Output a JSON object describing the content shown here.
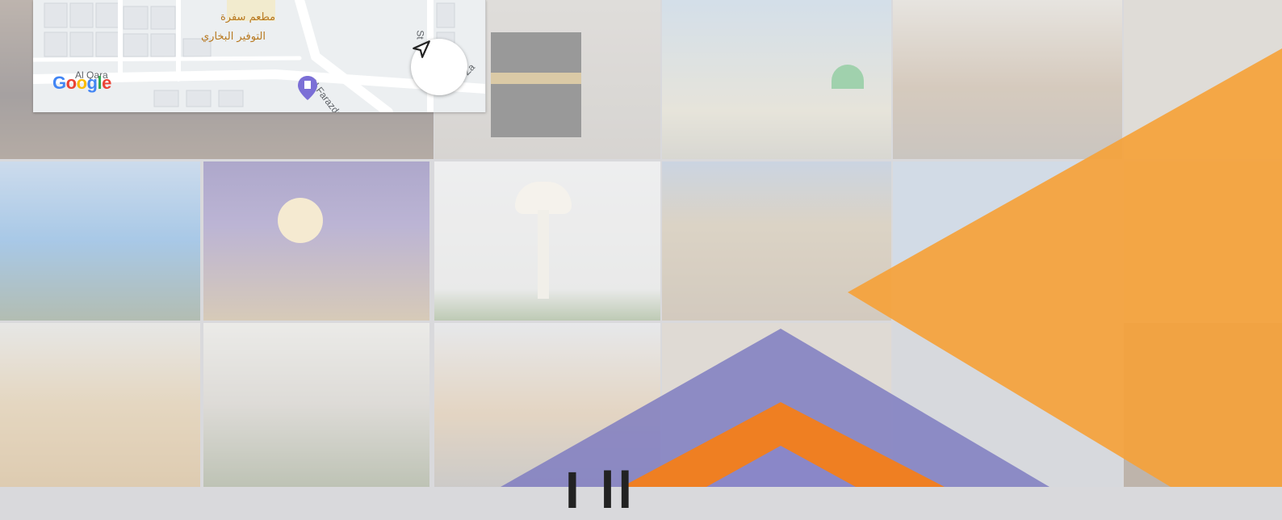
{
  "map": {
    "poi_1": "مطعم سفرة",
    "poi_2": "التوفير البخاري",
    "street_1": "Al Farazdaq St",
    "street_2": "St",
    "street_3": "Ibn Za",
    "district": "Al Qara",
    "logo": "Google"
  },
  "colors": {
    "orange_big": "#f5a23a",
    "indigo": "#8a87c8",
    "orange_roof": "#ef7f22"
  },
  "logo_partial": "I    ll"
}
